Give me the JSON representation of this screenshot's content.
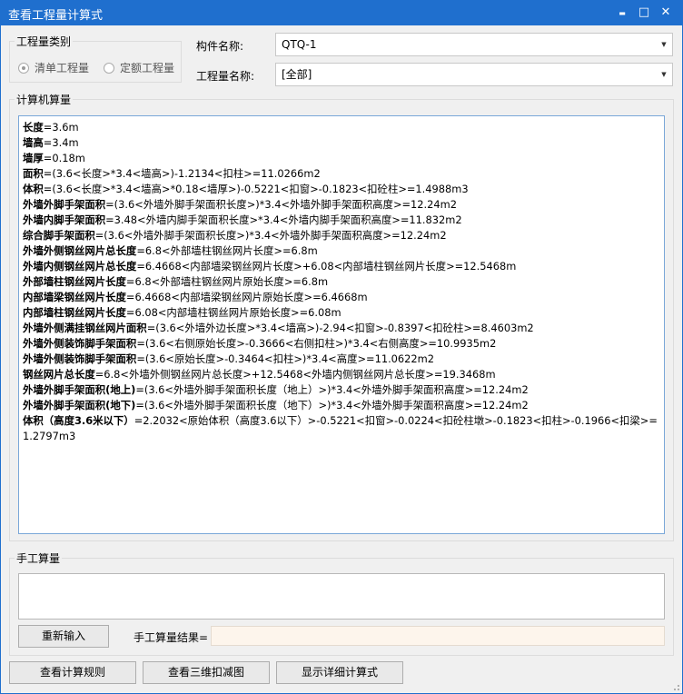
{
  "window": {
    "title": "查看工程量计算式",
    "controls": {
      "minimize": "▬",
      "restore": "□",
      "close": "✕"
    }
  },
  "category": {
    "legend": "工程量类别",
    "options": [
      {
        "label": "清单工程量",
        "selected": true
      },
      {
        "label": "定额工程量",
        "selected": false
      }
    ]
  },
  "component": {
    "label": "构件名称:",
    "value": "QTQ-1"
  },
  "quantity": {
    "label": "工程量名称:",
    "value": "[全部]"
  },
  "computer": {
    "legend": "计算机算量",
    "lines": [
      {
        "name": "长度",
        "expr": "=3.6m"
      },
      {
        "name": "墙高",
        "expr": "=3.4m"
      },
      {
        "name": "墙厚",
        "expr": "=0.18m"
      },
      {
        "name": "面积",
        "expr": "=(3.6<长度>*3.4<墙高>)-1.2134<扣柱>=11.0266m2"
      },
      {
        "name": "体积",
        "expr": "=(3.6<长度>*3.4<墙高>*0.18<墙厚>)-0.5221<扣窗>-0.1823<扣砼柱>=1.4988m3"
      },
      {
        "name": "外墙外脚手架面积",
        "expr": "=(3.6<外墙外脚手架面积长度>)*3.4<外墙外脚手架面积高度>=12.24m2"
      },
      {
        "name": "外墙内脚手架面积",
        "expr": "=3.48<外墙内脚手架面积长度>*3.4<外墙内脚手架面积高度>=11.832m2"
      },
      {
        "name": "综合脚手架面积",
        "expr": "=(3.6<外墙外脚手架面积长度>)*3.4<外墙外脚手架面积高度>=12.24m2"
      },
      {
        "name": "外墙外侧钢丝网片总长度",
        "expr": "=6.8<外部墙柱钢丝网片长度>=6.8m"
      },
      {
        "name": "外墙内侧钢丝网片总长度",
        "expr": "=6.4668<内部墙梁钢丝网片长度>+6.08<内部墙柱钢丝网片长度>=12.5468m"
      },
      {
        "name": "外部墙柱钢丝网片长度",
        "expr": "=6.8<外部墙柱钢丝网片原始长度>=6.8m"
      },
      {
        "name": "内部墙梁钢丝网片长度",
        "expr": "=6.4668<内部墙梁钢丝网片原始长度>=6.4668m"
      },
      {
        "name": "内部墙柱钢丝网片长度",
        "expr": "=6.08<内部墙柱钢丝网片原始长度>=6.08m"
      },
      {
        "name": "外墙外侧满挂钢丝网片面积",
        "expr": "=(3.6<外墙外边长度>*3.4<墙高>)-2.94<扣窗>-0.8397<扣砼柱>=8.4603m2"
      },
      {
        "name": "外墙外侧装饰脚手架面积",
        "expr": "=(3.6<右侧原始长度>-0.3666<右侧扣柱>)*3.4<右侧高度>=10.9935m2"
      },
      {
        "name": "外墙外侧装饰脚手架面积",
        "expr": "=(3.6<原始长度>-0.3464<扣柱>)*3.4<高度>=11.0622m2"
      },
      {
        "name": "钢丝网片总长度",
        "expr": "=6.8<外墙外侧钢丝网片总长度>+12.5468<外墙内侧钢丝网片总长度>=19.3468m"
      },
      {
        "name": "外墙外脚手架面积(地上)",
        "expr": "=(3.6<外墙外脚手架面积长度（地上）>)*3.4<外墙外脚手架面积高度>=12.24m2"
      },
      {
        "name": "外墙外脚手架面积(地下)",
        "expr": "=(3.6<外墙外脚手架面积长度（地下）>)*3.4<外墙外脚手架面积高度>=12.24m2"
      },
      {
        "name": "体积（高度3.6米以下）",
        "expr": "=2.2032<原始体积（高度3.6以下）>-0.5221<扣窗>-0.0224<扣砼柱墩>-0.1823<扣柱>-0.1966<扣梁>=1.2797m3"
      }
    ]
  },
  "manual": {
    "legend": "手工算量",
    "input_value": "",
    "reenter_label": "重新输入",
    "result_label": "手工算量结果=",
    "result_value": ""
  },
  "footer": {
    "rules_label": "查看计算规则",
    "view3d_label": "查看三维扣减图",
    "detail_label": "显示详细计算式"
  }
}
